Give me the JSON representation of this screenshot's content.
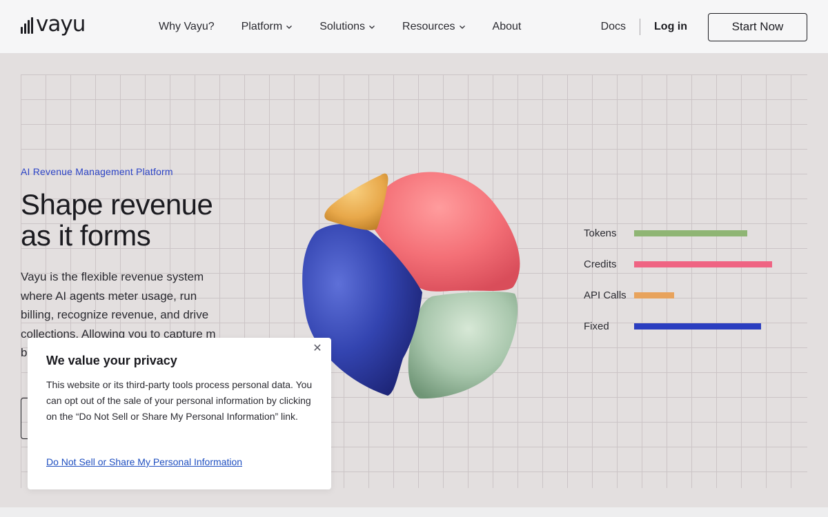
{
  "header": {
    "logo_text": "vayu",
    "nav": [
      {
        "label": "Why Vayu?",
        "has_dropdown": false
      },
      {
        "label": "Platform",
        "has_dropdown": true
      },
      {
        "label": "Solutions",
        "has_dropdown": true
      },
      {
        "label": "Resources",
        "has_dropdown": true
      },
      {
        "label": "About",
        "has_dropdown": false
      }
    ],
    "docs": "Docs",
    "login": "Log in",
    "start": "Start Now"
  },
  "hero": {
    "eyebrow": "AI Revenue Management Platform",
    "headline_line1": "Shape revenue",
    "headline_line2": "as it forms",
    "description": "Vayu is the flexible revenue system where AI agents meter usage, run billing, recognize revenue, and drive collections. Allowing you to capture m",
    "description_tail": "b"
  },
  "chart_data": {
    "type": "bar",
    "orientation": "horizontal",
    "categories": [
      "Tokens",
      "Credits",
      "API Calls",
      "Fixed"
    ],
    "values": [
      82,
      100,
      29,
      92
    ],
    "colors": [
      "#8fb574",
      "#ef6483",
      "#e8a35c",
      "#2b3ec0"
    ],
    "xlim": [
      0,
      100
    ]
  },
  "illustration": {
    "type": "pie",
    "slices": [
      {
        "name": "pink",
        "color": "#f47077"
      },
      {
        "name": "green",
        "color": "#a9c7ad"
      },
      {
        "name": "blue",
        "color": "#3344b0"
      },
      {
        "name": "orange",
        "color": "#e8a84a"
      }
    ]
  },
  "privacy": {
    "title": "We value your privacy",
    "body": "This website or its third-party tools process personal data. You can opt out of the sale of your personal information by clicking on the “Do Not Sell or Share My Personal Information” link.",
    "link": "Do Not Sell or Share My Personal Information",
    "close_icon": "close-icon"
  }
}
